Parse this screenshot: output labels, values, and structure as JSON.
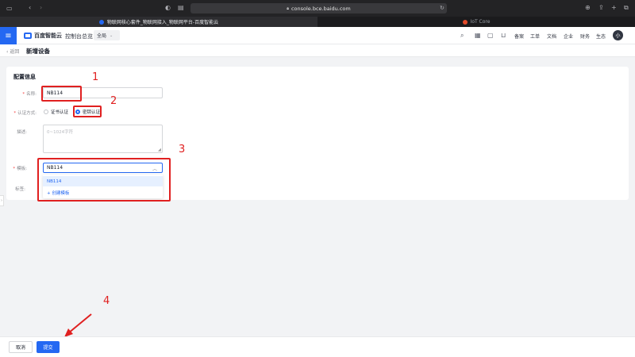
{
  "browser": {
    "url": "console.bce.baidu.com",
    "tabs": [
      {
        "title": "物联网核心套件_物联网接入_物联网平台-百度智能云",
        "active": true
      },
      {
        "title": "IoT Core",
        "active": false
      }
    ]
  },
  "header": {
    "brand": "百度智能云",
    "console": "控制台总览",
    "region": "全局",
    "nav": [
      "备案",
      "工单",
      "文档",
      "企业",
      "财务",
      "生态"
    ],
    "avatar": "小"
  },
  "page": {
    "back": "返回",
    "title": "新增设备"
  },
  "form": {
    "section_title": "配置信息",
    "name_label": "名称:",
    "name_value": "NB114",
    "auth_label": "认证方式:",
    "auth_options": [
      "证书认证",
      "密钥认证"
    ],
    "auth_selected": "密钥认证",
    "desc_label": "描述:",
    "desc_placeholder": "0~1024字符",
    "model_label": "模板:",
    "model_value": "NB114",
    "model_options": [
      "NB114"
    ],
    "create_model": "+ 创建模板",
    "tag_label": "标签:"
  },
  "annotations": [
    "1",
    "2",
    "3",
    "4"
  ],
  "footer": {
    "cancel": "取消",
    "submit": "提交"
  },
  "colors": {
    "accent": "#2468f2",
    "annotation": "#e02020"
  }
}
